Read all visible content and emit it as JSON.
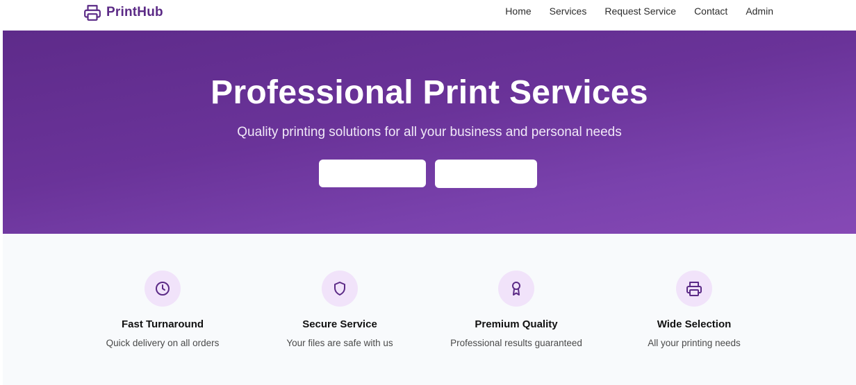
{
  "brand": {
    "name": "PrintHub",
    "icon": "printer-icon",
    "color": "#5b2a86"
  },
  "nav": {
    "items": [
      {
        "label": "Home"
      },
      {
        "label": "Services"
      },
      {
        "label": "Request Service"
      },
      {
        "label": "Contact"
      },
      {
        "label": "Admin"
      }
    ]
  },
  "hero": {
    "title": "Professional Print Services",
    "subtitle": "Quality printing solutions for all your business and personal needs",
    "gradient": [
      "#5e2b8a",
      "#8649b5"
    ],
    "buttons": [
      {
        "label": ""
      },
      {
        "label": ""
      }
    ]
  },
  "features": [
    {
      "icon": "clock-icon",
      "title": "Fast Turnaround",
      "description": "Quick delivery on all orders"
    },
    {
      "icon": "shield-icon",
      "title": "Secure Service",
      "description": "Your files are safe with us"
    },
    {
      "icon": "award-icon",
      "title": "Premium Quality",
      "description": "Professional results guaranteed"
    },
    {
      "icon": "printer-icon",
      "title": "Wide Selection",
      "description": "All your printing needs"
    }
  ],
  "colors": {
    "accent": "#5b2a86",
    "icon_bg": "#f1e3fa",
    "features_bg": "#f8fafc"
  }
}
